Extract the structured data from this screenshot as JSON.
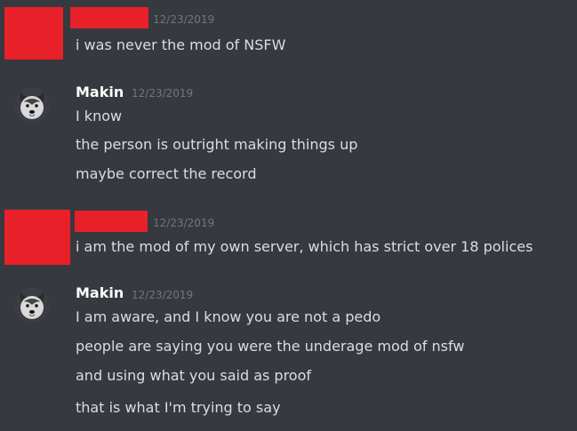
{
  "messages": [
    {
      "author": "",
      "timestamp": "12/23/2019",
      "lines": [
        "i was never the mod of NSFW"
      ]
    },
    {
      "author": "Makin",
      "timestamp": "12/23/2019",
      "lines": [
        "I know",
        "the person is outright making things up",
        "maybe correct the record"
      ]
    },
    {
      "author": "",
      "timestamp": "12/23/2019",
      "lines": [
        "i am the mod of my own server, which has strict over 18 polices"
      ]
    },
    {
      "author": "Makin",
      "timestamp": "12/23/2019",
      "lines": [
        "I am aware, and I know you are not a pedo",
        "people are saying you were the underage mod of nsfw",
        "and using what you said as proof",
        "that is what I'm trying to say"
      ]
    }
  ],
  "colors": {
    "background": "#36393f",
    "redaction": "#e8202a",
    "username": "#ffffff",
    "timestamp": "#72767d",
    "message_text": "#dcddde"
  },
  "icons": {
    "makin_avatar": "husky-avatar-icon"
  }
}
